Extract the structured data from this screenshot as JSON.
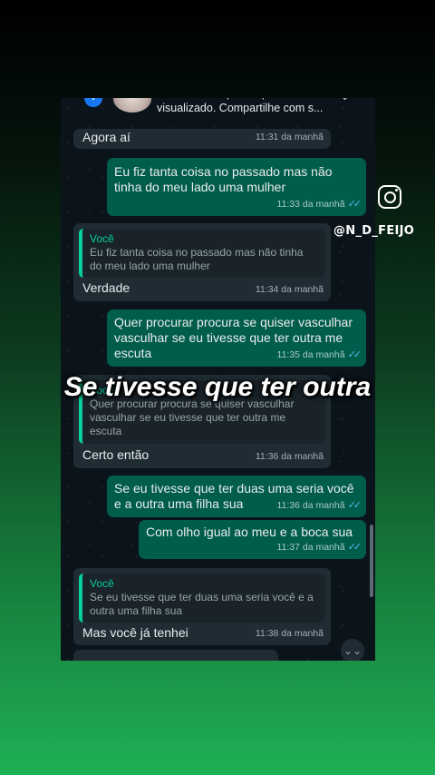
{
  "notification": {
    "app_icon": "facebook-icon",
    "text": "Seu reel está pronto para ser visualizado. Compartilhe com s..."
  },
  "overlay": {
    "caption": "Se tivesse que ter outra",
    "instagram_icon": "instagram-icon",
    "handle": "@N_D_FEIJO"
  },
  "messages": [
    {
      "type": "in",
      "text": "Agora aí",
      "time": "11:31 da manhã"
    },
    {
      "type": "out",
      "text": "Eu fiz tanta coisa no passado mas não tinha do meu lado uma mulher",
      "time": "11:33 da manhã"
    },
    {
      "type": "in",
      "quote_author": "Você",
      "quote_text": "Eu fiz tanta coisa no passado mas não tinha do meu lado uma mulher",
      "text": "Verdade",
      "time": "11:34 da manhã"
    },
    {
      "type": "out",
      "text": "Quer procurar procura se quiser vasculhar vasculhar se eu tivesse que ter outra me escuta",
      "time": "11:35 da manhã"
    },
    {
      "type": "in",
      "quote_author": "Você",
      "quote_text": "Quer procurar procura se quiser vasculhar vasculhar se eu tivesse que ter outra me escuta",
      "text": "Certo então",
      "time": "11:36 da manhã"
    },
    {
      "type": "out",
      "text": "Se eu tivesse que ter duas uma seria você e a outra uma filha sua",
      "time": "11:36 da manhã"
    },
    {
      "type": "out",
      "text": "Com olho igual ao meu e a boca sua",
      "time": "11:37 da manhã"
    },
    {
      "type": "in",
      "quote_author": "Você",
      "quote_text": "Se eu tivesse que ter duas uma seria você e a outra uma filha sua",
      "text": "Mas você já tenhei",
      "time": "11:38 da manhã"
    }
  ],
  "colors": {
    "incoming_bubble": "#202c33",
    "outgoing_bubble": "#005c4b",
    "chat_background": "#0b141a",
    "quote_accent": "#06cf9c",
    "read_ticks": "#53bdeb"
  }
}
